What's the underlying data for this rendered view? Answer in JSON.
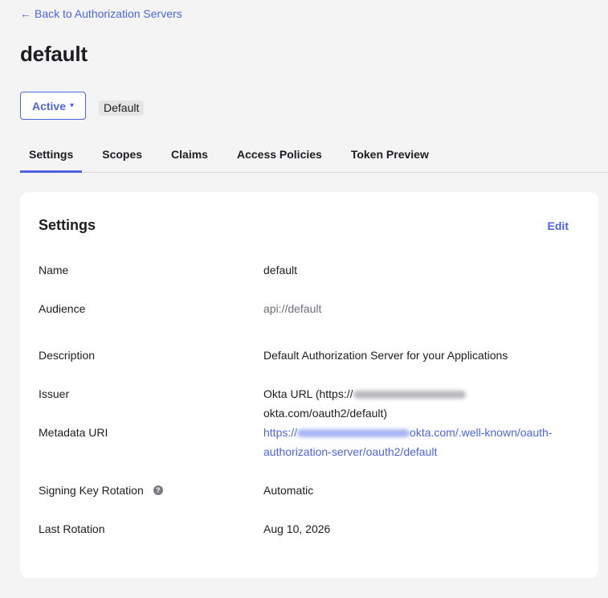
{
  "nav": {
    "back_arrow": "←",
    "back_label": "Back to Authorization Servers"
  },
  "page": {
    "title": "default"
  },
  "status": {
    "label": "Active",
    "caret": "▾",
    "badge": "Default"
  },
  "tabs": [
    {
      "label": "Settings",
      "active": true
    },
    {
      "label": "Scopes"
    },
    {
      "label": "Claims"
    },
    {
      "label": "Access Policies"
    },
    {
      "label": "Token Preview"
    }
  ],
  "settings": {
    "title": "Settings",
    "edit_label": "Edit",
    "fields": {
      "name": {
        "label": "Name",
        "value": "default"
      },
      "audience": {
        "label": "Audience",
        "value": "api://default"
      },
      "description": {
        "label": "Description",
        "value": "Default Authorization Server for your Applications"
      },
      "issuer": {
        "label": "Issuer",
        "prefix": "Okta URL (https://",
        "suffix": "okta.com/oauth2/default)"
      },
      "metadata_uri": {
        "label": "Metadata URI",
        "prefix": "https://",
        "suffix": "okta.com/.well-known/oauth-authorization-server/oauth2/default"
      },
      "signing_key_rotation": {
        "label": "Signing Key Rotation",
        "help_icon": "?",
        "value": "Automatic"
      },
      "last_rotation": {
        "label": "Last Rotation",
        "value": "Aug 10, 2026"
      }
    }
  },
  "colors": {
    "accent": "#4c64e1",
    "background": "#f4f4f4",
    "card": "#ffffff"
  },
  "icons": {
    "back": "arrow-left-icon",
    "caret": "caret-down-icon",
    "help": "question-circle-icon"
  }
}
